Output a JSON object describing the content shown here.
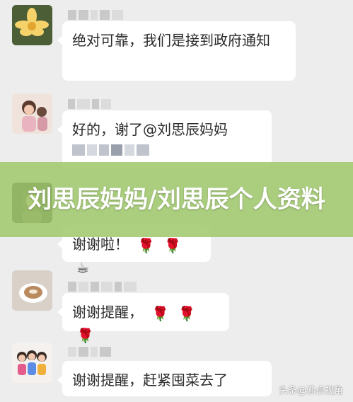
{
  "messages": [
    {
      "text": "绝对可靠，我们是接到政府通知"
    },
    {
      "text": "好的，谢了@刘思辰妈妈"
    },
    {
      "text": "谢谢啦！"
    },
    {
      "text": "谢谢提醒，"
    },
    {
      "text": "谢谢提醒，赶紧囤菜去了"
    }
  ],
  "banner": {
    "title": "刘思辰妈妈/刘思辰个人资料"
  },
  "watermark": "头条@沸点视角",
  "colors": {
    "background": "#ededed",
    "bubble": "#ffffff",
    "banner": "#a0c86e"
  }
}
